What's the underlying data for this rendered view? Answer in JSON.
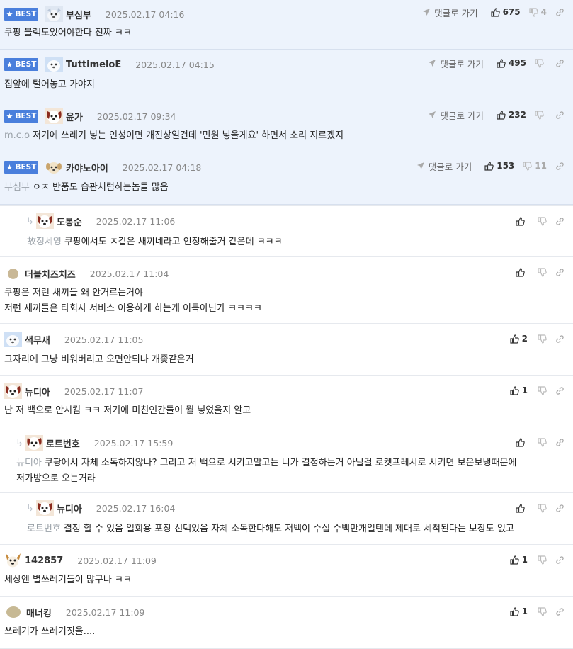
{
  "labels": {
    "best": "BEST",
    "goto": "댓글로 가기"
  },
  "comments": [
    {
      "best": true,
      "nick": "부심부",
      "date": "2025.02.17 04:16",
      "mention": "",
      "lines": [
        "쿠팡 블랙도있어야한다 진짜 ㅋㅋ"
      ],
      "likes": "675",
      "dislikes": "4",
      "avatar": "dog-avatar"
    },
    {
      "best": true,
      "nick": "TuttimeloE",
      "date": "2025.02.17 04:15",
      "mention": "",
      "lines": [
        "집앞에 털어놓고 가야지"
      ],
      "likes": "495",
      "dislikes": "",
      "avatar": "dog-avatar"
    },
    {
      "best": true,
      "nick": "윤가",
      "date": "2025.02.17 09:34",
      "mention": "m.c.o",
      "lines": [
        "저기에 쓰레기 넣는 인성이면 개진상일건데 '민원 넣을게요' 하면서 소리 지르겠지"
      ],
      "likes": "232",
      "dislikes": "",
      "avatar": "dog-avatar"
    },
    {
      "best": true,
      "nick": "카야노아이",
      "date": "2025.02.17 04:18",
      "mention": "부심부",
      "lines": [
        "ㅇㅈ 반품도 습관처럼하는놈들 많음"
      ],
      "likes": "153",
      "dislikes": "11",
      "avatar": "puppy-avatar"
    },
    {
      "best": false,
      "reply": true,
      "nick": "도봉순",
      "date": "2025.02.17 11:06",
      "mention": "故정세영",
      "lines": [
        "쿠팡에서도 ㅈ같은 새끼네라고 인정해줄거 같은데 ㅋㅋㅋ"
      ],
      "likes": "",
      "dislikes": "",
      "avatar": "dog-avatar"
    },
    {
      "best": false,
      "nick": "더블치즈치즈",
      "date": "2025.02.17 11:04",
      "mention": "",
      "lines": [
        "쿠팡은 저런 새끼들 왜 안거르는거야",
        "저런 새끼들은 타회사 서비스 이용하게 하는게 이득아닌가 ㅋㅋㅋㅋ"
      ],
      "likes": "",
      "dislikes": "",
      "avatar": "round-avatar"
    },
    {
      "best": false,
      "nick": "색무새",
      "date": "2025.02.17 11:05",
      "mention": "",
      "lines": [
        "그자리에 그냥 비워버리고 오면안되나 개좆같은거"
      ],
      "likes": "2",
      "dislikes": "",
      "avatar": "dog-avatar"
    },
    {
      "best": false,
      "nick": "뉴디아",
      "date": "2025.02.17 11:07",
      "mention": "",
      "lines": [
        "난 저 백으로 안시킴 ㅋㅋ 저기에 미친인간들이 뭘 넣었을지 알고"
      ],
      "likes": "1",
      "dislikes": "",
      "avatar": "dog-avatar"
    },
    {
      "best": false,
      "reply": true,
      "nick": "로트번호",
      "date": "2025.02.17 15:59",
      "mention": "뉴디아",
      "lines": [
        "쿠팡에서 자체 소독하지않나? 그리고 저 백으로 시키고말고는 니가 결정하는거 아닐걸 로켓프레시로 시키면 보온보냉때문에",
        "저가방으로 오는거라"
      ],
      "likes": "",
      "dislikes": "",
      "avatar": "dog-avatar"
    },
    {
      "best": false,
      "reply": true,
      "nick": "뉴디아",
      "date": "2025.02.17 16:04",
      "mention": "로트번호",
      "lines": [
        "결정 할 수 있음 일회용 포장 선택있음 자체 소독한다해도 저백이 수십 수백만개일텐데 제대로 세척된다는 보장도 없고"
      ],
      "likes": "",
      "dislikes": "",
      "avatar": "dog-avatar"
    },
    {
      "best": false,
      "nick": "142857",
      "date": "2025.02.17 11:09",
      "mention": "",
      "lines": [
        "세상엔 별쓰레기들이 많구나 ㅋㅋ"
      ],
      "likes": "1",
      "dislikes": "",
      "avatar": "puppy-avatar"
    },
    {
      "best": false,
      "nick": "매너킹",
      "date": "2025.02.17 11:09",
      "mention": "",
      "lines": [
        "쓰레기가 쓰레기짓을...."
      ],
      "likes": "1",
      "dislikes": "",
      "avatar": "round-avatar"
    }
  ]
}
